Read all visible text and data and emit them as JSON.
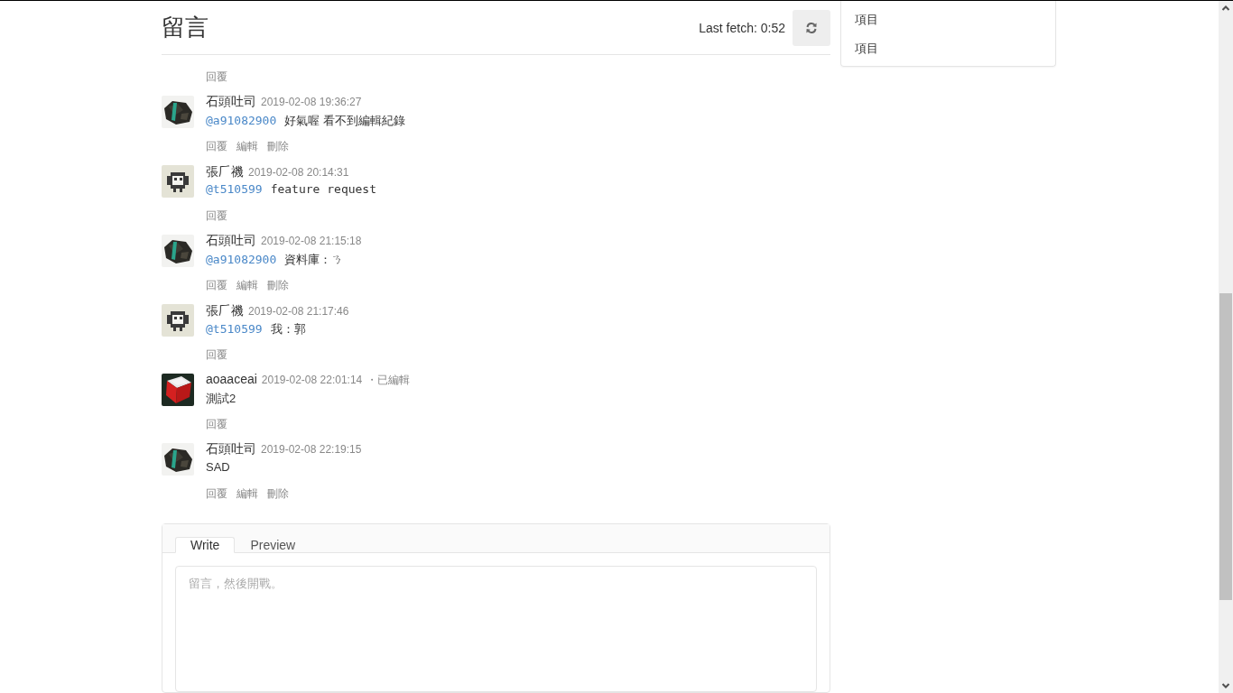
{
  "header": {
    "title": "留言",
    "last_fetch": "Last fetch: 0:52"
  },
  "top_actions": [
    "回覆"
  ],
  "comments": [
    {
      "avatar": {
        "kind": "rock"
      },
      "author": "石頭吐司",
      "time": "2019-02-08 19:36:27",
      "mention": "@a91082900",
      "body": {
        "kind": "plain",
        "text": "好氣喔  看不到編輯紀錄"
      },
      "actions": [
        "回覆",
        "編輯",
        "刪除"
      ]
    },
    {
      "avatar": {
        "kind": "bird"
      },
      "author": "張𠂆禨",
      "time": "2019-02-08 20:14:31",
      "mention": "@t510599",
      "body": {
        "kind": "code",
        "text": "feature request"
      },
      "actions": [
        "回覆"
      ]
    },
    {
      "avatar": {
        "kind": "rock"
      },
      "author": "石頭吐司",
      "time": "2019-02-08 21:15:18",
      "mention": "@a91082900",
      "body": {
        "kind": "plain",
        "text": "資料庫：ㄋ"
      },
      "actions": [
        "回覆",
        "編輯",
        "刪除"
      ]
    },
    {
      "avatar": {
        "kind": "bird"
      },
      "author": "張𠂆禨",
      "time": "2019-02-08 21:17:46",
      "mention": "@t510599",
      "body": {
        "kind": "plain",
        "text": "我：郭"
      },
      "actions": [
        "回覆"
      ]
    },
    {
      "avatar": {
        "kind": "cube"
      },
      "author": "aoaaceai",
      "time": "2019-02-08 22:01:14",
      "edited": "・已編輯",
      "body": {
        "kind": "plain",
        "text": "測試2"
      },
      "actions": [
        "回覆"
      ]
    },
    {
      "avatar": {
        "kind": "rock"
      },
      "author": "石頭吐司",
      "time": "2019-02-08 22:19:15",
      "body": {
        "kind": "plain",
        "text": "SAD"
      },
      "actions": [
        "回覆",
        "編輯",
        "刪除"
      ]
    }
  ],
  "editor": {
    "tabs": [
      {
        "label": "Write",
        "selected": true
      },
      {
        "label": "Preview",
        "selected": false
      }
    ],
    "placeholder": "留言，然後開戰。"
  },
  "sidebar": {
    "items": [
      "項目",
      "項目"
    ]
  }
}
